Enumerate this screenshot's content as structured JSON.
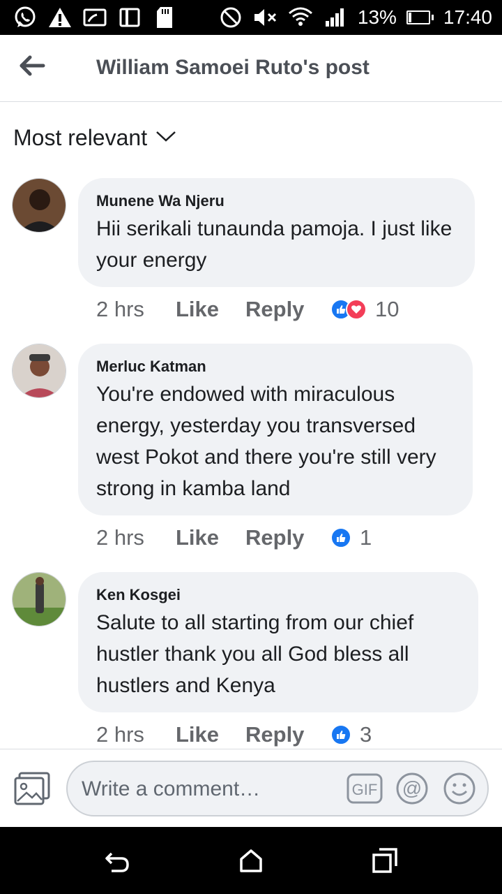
{
  "statusbar": {
    "battery_percent": "13%",
    "time": "17:40",
    "icons": [
      "whatsapp-icon",
      "warning-icon",
      "cast-icon",
      "device-icon",
      "sd-card-icon",
      "do-not-disturb-icon",
      "mute-icon",
      "wifi-icon",
      "signal-icon"
    ]
  },
  "header": {
    "title": "William Samoei Ruto's post"
  },
  "sort": {
    "label": "Most relevant"
  },
  "comments": [
    {
      "author": "Munene Wa Njeru",
      "text": "Hii serikali tunaunda pamoja. I just like your energy",
      "time": "2 hrs",
      "like_label": "Like",
      "reply_label": "Reply",
      "reactions": [
        "like",
        "love"
      ],
      "reaction_count": "10"
    },
    {
      "author": "Merluc Katman",
      "text": "You're endowed with miraculous energy, yesterday you transversed west Pokot and there you're still very strong in kamba land",
      "time": "2 hrs",
      "like_label": "Like",
      "reply_label": "Reply",
      "reactions": [
        "like"
      ],
      "reaction_count": "1"
    },
    {
      "author": "Ken Kosgei",
      "text": "Salute to all starting from our chief hustler thank you all God bless all hustlers and Kenya",
      "time": "2 hrs",
      "like_label": "Like",
      "reply_label": "Reply",
      "reactions": [
        "like"
      ],
      "reaction_count": "3"
    }
  ],
  "composer": {
    "placeholder": "Write a comment…"
  },
  "colors": {
    "like_blue": "#1877f2",
    "love_red": "#f33e58",
    "bubble_bg": "#f0f2f5",
    "meta_gray": "#65676b"
  }
}
